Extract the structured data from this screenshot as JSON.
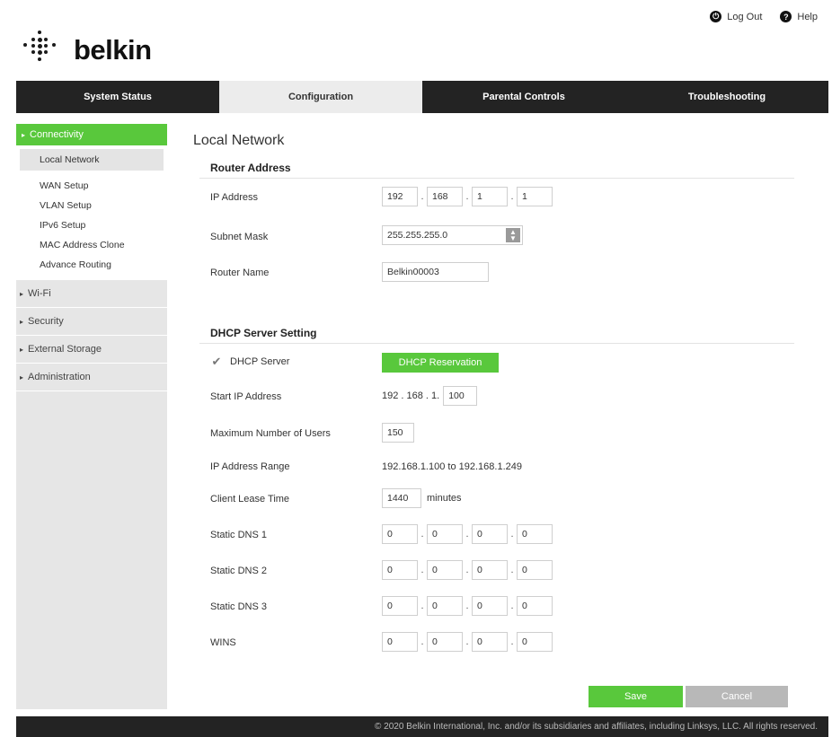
{
  "header": {
    "brand": "belkin",
    "logout_label": "Log Out",
    "help_label": "Help"
  },
  "nav": {
    "tabs": [
      {
        "label": "System Status"
      },
      {
        "label": "Configuration"
      },
      {
        "label": "Parental Controls"
      },
      {
        "label": "Troubleshooting"
      }
    ],
    "active": "Configuration"
  },
  "sidebar": {
    "active_group": "Connectivity",
    "sub_items": [
      {
        "label": "Local Network"
      },
      {
        "label": "WAN Setup"
      },
      {
        "label": "VLAN Setup"
      },
      {
        "label": "IPv6 Setup"
      },
      {
        "label": "MAC Address Clone"
      },
      {
        "label": "Advance Routing"
      }
    ],
    "groups": [
      {
        "label": "Wi-Fi"
      },
      {
        "label": "Security"
      },
      {
        "label": "External Storage"
      },
      {
        "label": "Administration"
      }
    ]
  },
  "page": {
    "title": "Local Network",
    "router_address": {
      "title": "Router Address",
      "ip_label": "IP Address",
      "ip": [
        "192",
        "168",
        "1",
        "1"
      ],
      "subnet_label": "Subnet Mask",
      "subnet_value": "255.255.255.0",
      "router_name_label": "Router Name",
      "router_name": "Belkin00003"
    },
    "dhcp": {
      "title": "DHCP Server Setting",
      "server_label": "DHCP Server",
      "server_enabled": true,
      "reservation_label": "DHCP Reservation",
      "start_ip_label": "Start IP Address",
      "start_ip_prefix": "192 . 168 . 1.",
      "start_ip_last": "100",
      "max_users_label": "Maximum Number of Users",
      "max_users": "150",
      "range_label": "IP Address Range",
      "range_value": "192.168.1.100 to 192.168.1.249",
      "lease_label": "Client Lease Time",
      "lease_value": "1440",
      "lease_unit": "minutes",
      "dns1_label": "Static DNS 1",
      "dns1": [
        "0",
        "0",
        "0",
        "0"
      ],
      "dns2_label": "Static DNS 2",
      "dns2": [
        "0",
        "0",
        "0",
        "0"
      ],
      "dns3_label": "Static DNS 3",
      "dns3": [
        "0",
        "0",
        "0",
        "0"
      ],
      "wins_label": "WINS",
      "wins": [
        "0",
        "0",
        "0",
        "0"
      ]
    },
    "save_label": "Save",
    "cancel_label": "Cancel"
  },
  "footer": {
    "copyright": "© 2020 Belkin International, Inc. and/or its subsidiaries and affiliates, including Linksys, LLC. All rights reserved."
  },
  "colors": {
    "accent_green": "#59c83c",
    "nav_dark": "#232323",
    "sidebar_grey": "#e6e6e6"
  }
}
